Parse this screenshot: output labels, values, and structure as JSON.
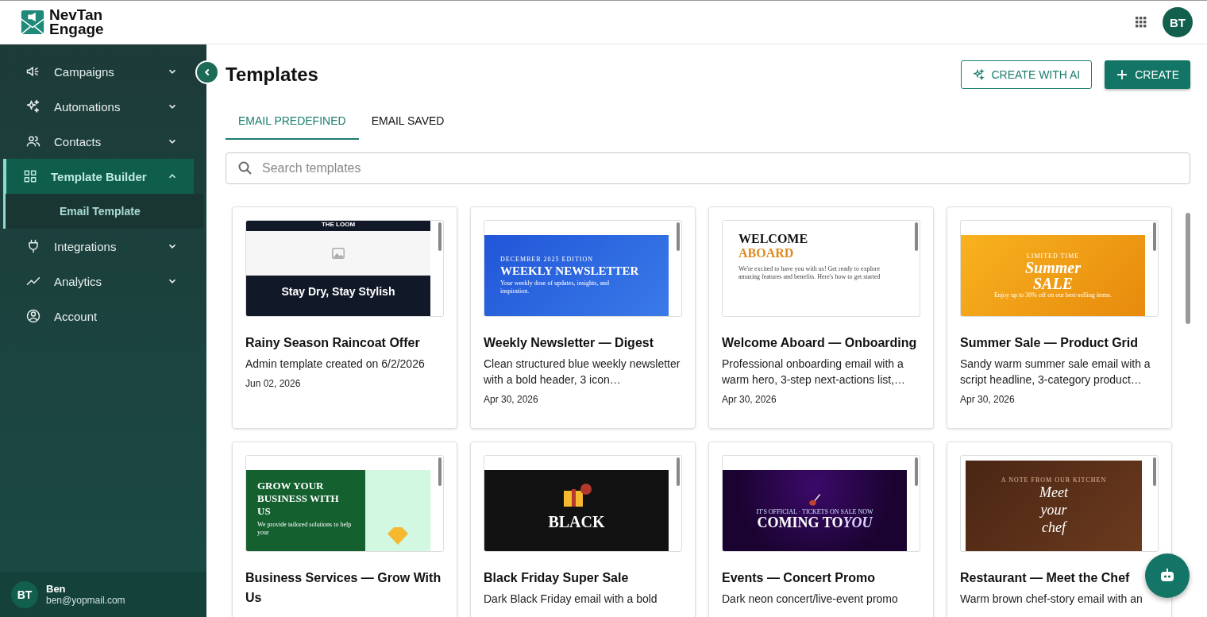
{
  "brand": {
    "name_line1": "NevTan",
    "name_line2": "Engage"
  },
  "user": {
    "initials": "BT",
    "panel_initials": "BT",
    "name": "Ben",
    "email": "ben@yopmail.com"
  },
  "sidebar": {
    "items": [
      {
        "label": "Campaigns",
        "kind": "group",
        "expanded": false,
        "selected": false
      },
      {
        "label": "Automations",
        "kind": "group",
        "expanded": false,
        "selected": false
      },
      {
        "label": "Contacts",
        "kind": "group",
        "expanded": false,
        "selected": false
      },
      {
        "label": "Template Builder",
        "kind": "group",
        "expanded": true,
        "selected": true,
        "children": [
          {
            "label": "Email Template",
            "selected": true
          }
        ]
      },
      {
        "label": "Integrations",
        "kind": "group",
        "expanded": false,
        "selected": false
      },
      {
        "label": "Analytics",
        "kind": "group",
        "expanded": false,
        "selected": false
      },
      {
        "label": "Account",
        "kind": "link",
        "selected": false
      }
    ]
  },
  "page": {
    "title": "Templates",
    "buttons": [
      {
        "label": "CREATE WITH AI",
        "kind": "outline"
      },
      {
        "label": "CREATE",
        "kind": "primary"
      }
    ]
  },
  "tabs": [
    {
      "label": "EMAIL PREDEFINED",
      "selected": true
    },
    {
      "label": "EMAIL SAVED",
      "selected": false
    }
  ],
  "search": {
    "placeholder": "Search templates"
  },
  "templates": [
    {
      "title": "Rainy Season Raincoat Offer",
      "description": "Admin template created on 6/2/2026",
      "date": "Jun 02, 2026",
      "preview": {
        "kind": "image-hero",
        "kicker": "THE LOOM",
        "headline": "Stay Dry, Stay Stylish"
      }
    },
    {
      "title": "Weekly Newsletter — Digest",
      "description": "Clean structured blue weekly newsletter with a bold header, 3 icon…",
      "date": "Apr 30, 2026",
      "preview": {
        "kind": "blue",
        "kicker": "DECEMBER 2025 EDITION",
        "headline": "WEEKLY NEWSLETTER",
        "body": "Your weekly dose of updates, insights, and inspiration."
      }
    },
    {
      "title": "Welcome Aboard — Onboarding",
      "description": "Professional onboarding email with a warm hero, 3-step next-actions list,…",
      "date": "Apr 30, 2026",
      "preview": {
        "kind": "welcome",
        "headline": "WELCOME",
        "accent": "ABOARD",
        "body": "We're excited to have you with us! Get ready to explore amazing features and benefits. Here's how to get started"
      }
    },
    {
      "title": "Summer Sale — Product Grid",
      "description": "Sandy warm summer sale email with a script headline, 3-category product…",
      "date": "Apr 30, 2026",
      "preview": {
        "kind": "orange",
        "kicker": "LIMITED TIME",
        "headline": "Summer SALE",
        "body": "Enjoy up to 30% off on our best-selling items."
      }
    },
    {
      "title": "Business Services — Grow With Us",
      "preview": {
        "kind": "green-split",
        "headline": "GROW YOUR BUSINESS WITH US",
        "body": "We provide tailored solutions to help your"
      }
    },
    {
      "title": "Black Friday Super Sale",
      "description": "Dark Black Friday email with a bold",
      "preview": {
        "kind": "dark-gift",
        "headline": "BLACK"
      }
    },
    {
      "title": "Events — Concert Promo",
      "description": "Dark neon concert/live-event promo",
      "preview": {
        "kind": "neon",
        "kicker": "IT'S OFFICIAL · TICKETS ON SALE NOW",
        "headline": "COMING TO",
        "accent": "YOU"
      }
    },
    {
      "title": "Restaurant — Meet the Chef",
      "description": "Warm brown chef-story email with an",
      "preview": {
        "kind": "brown",
        "kicker": "A NOTE FROM OUR KITCHEN",
        "headline": "Meet your chef"
      }
    }
  ]
}
